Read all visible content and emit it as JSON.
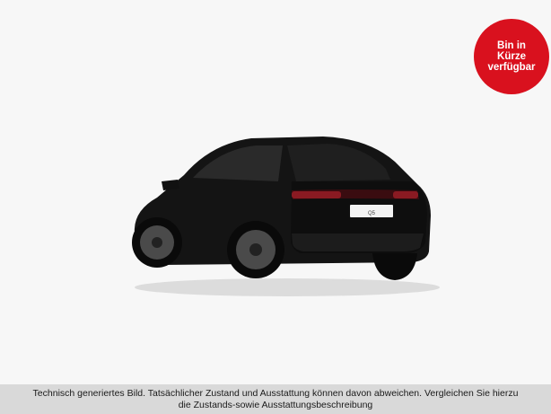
{
  "colors": {
    "background": "#f7f7f7",
    "badge": "#d9111e",
    "disclaimer_bar": "#d9d9d9",
    "car_body": "#141414"
  },
  "badge": {
    "line1": "Bin in",
    "line2": "Kürze",
    "line3": "verfügbar"
  },
  "car": {
    "icon": "car-rear-image",
    "plate_text": "Q5"
  },
  "disclaimer": {
    "line1": "Technisch generiertes Bild. Tatsächlicher Zustand und Ausstattung können davon abweichen. Vergleichen Sie hierzu",
    "line2": "die Zustands-sowie Ausstattungsbeschreibung"
  }
}
